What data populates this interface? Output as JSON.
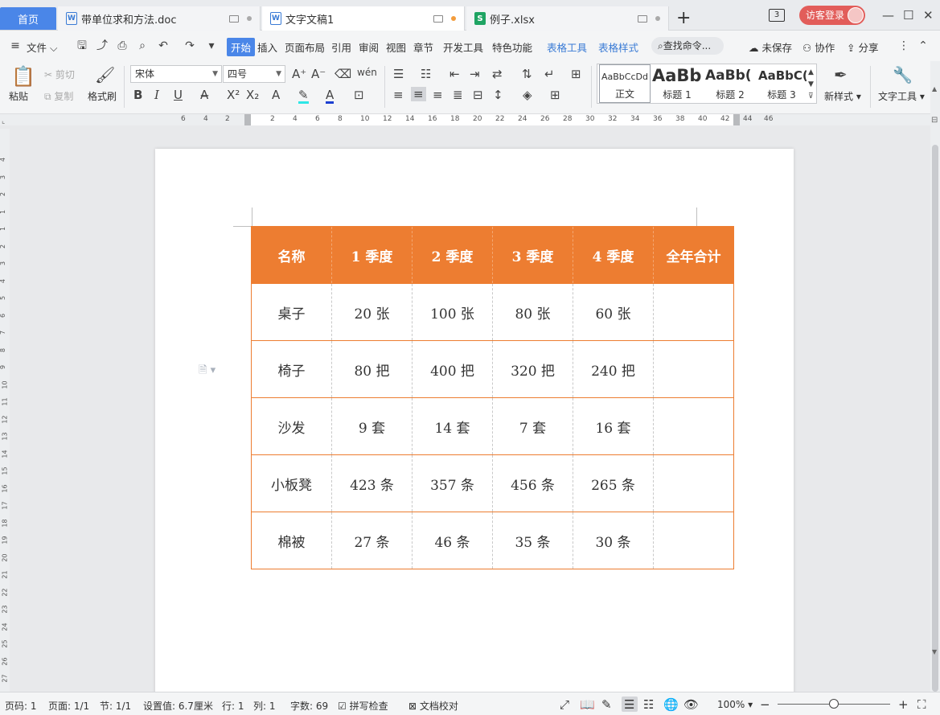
{
  "tabs": [
    {
      "label": "首页"
    },
    {
      "label": "带单位求和方法.doc"
    },
    {
      "label": "文字文稿1"
    },
    {
      "label": "例子.xlsx"
    }
  ],
  "window": {
    "badge": "3",
    "login": "访客登录"
  },
  "menu": {
    "file": "文件",
    "items": [
      "开始",
      "插入",
      "页面布局",
      "引用",
      "审阅",
      "视图",
      "章节",
      "开发工具",
      "特色功能"
    ],
    "context_items": [
      "表格工具",
      "表格样式"
    ],
    "search_placeholder": "查找命令...",
    "unsaved": "未保存",
    "collab": "协作",
    "share": "分享"
  },
  "ribbon": {
    "paste": "粘贴",
    "cut": "剪切",
    "copy": "复制",
    "format_painter": "格式刷",
    "font_name": "宋体",
    "font_size": "四号",
    "styles": [
      {
        "sample": "AaBbCcDd",
        "name": "正文"
      },
      {
        "sample": "AaBb",
        "name": "标题 1"
      },
      {
        "sample": "AaBb(",
        "name": "标题 2"
      },
      {
        "sample": "AaBbC(",
        "name": "标题 3"
      }
    ],
    "new_style": "新样式",
    "text_tools": "文字工具"
  },
  "table": {
    "headers": [
      "名称",
      "1 季度",
      "2 季度",
      "3 季度",
      "4 季度",
      "全年合计"
    ],
    "rows": [
      [
        "桌子",
        "20 张",
        "100 张",
        "80 张",
        "60 张",
        ""
      ],
      [
        "椅子",
        "80 把",
        "400 把",
        "320 把",
        "240 把",
        ""
      ],
      [
        "沙发",
        "9 套",
        "14 套",
        "7 套",
        "16 套",
        ""
      ],
      [
        "小板凳",
        "423 条",
        "357 条",
        "456 条",
        "265 条",
        ""
      ],
      [
        "棉被",
        "27 条",
        "46 条",
        "35 条",
        "30 条",
        ""
      ]
    ]
  },
  "ruler": {
    "h_numbers": [
      "6",
      "4",
      "2",
      "2",
      "4",
      "6",
      "8",
      "10",
      "12",
      "14",
      "16",
      "18",
      "20",
      "22",
      "24",
      "26",
      "28",
      "30",
      "32",
      "34",
      "36",
      "38",
      "40",
      "42",
      "44",
      "46"
    ],
    "v_numbers": [
      "4",
      "3",
      "2",
      "1",
      "1",
      "2",
      "3",
      "4",
      "5",
      "6",
      "7",
      "8",
      "9",
      "10",
      "11",
      "12",
      "13",
      "14",
      "15",
      "16",
      "17",
      "18",
      "19",
      "20",
      "21",
      "22",
      "23",
      "24",
      "25",
      "26",
      "27"
    ]
  },
  "status": {
    "page_code": "页码: 1",
    "page": "页面: 1/1",
    "section": "节: 1/1",
    "setting": "设置值: 6.7厘米",
    "row": "行: 1",
    "col": "列: 1",
    "words": "字数: 69",
    "spell": "拼写检查",
    "proof": "文档校对",
    "zoom": "100%"
  },
  "colors": {
    "accent": "#4a86e8",
    "table_header": "#ed7d31",
    "login": "#e25d5a"
  }
}
